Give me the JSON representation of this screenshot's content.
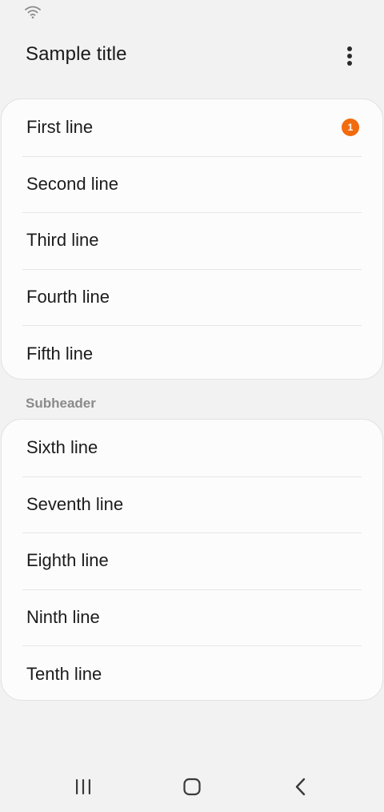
{
  "status_bar": {
    "wifi_icon": "wifi-icon"
  },
  "app_bar": {
    "title": "Sample title",
    "more_icon": "more-vertical-icon"
  },
  "group1": {
    "items": [
      {
        "label": "First line",
        "badge": "1"
      },
      {
        "label": "Second line"
      },
      {
        "label": "Third line"
      },
      {
        "label": "Fourth line"
      },
      {
        "label": "Fifth line"
      }
    ]
  },
  "subheader": "Subheader",
  "group2": {
    "items": [
      {
        "label": "Sixth line"
      },
      {
        "label": "Seventh line"
      },
      {
        "label": "Eighth line"
      },
      {
        "label": "Ninth line"
      },
      {
        "label": "Tenth line"
      }
    ]
  },
  "nav_bar": {
    "recents_icon": "recents-icon",
    "home_icon": "home-icon",
    "back_icon": "back-icon"
  },
  "colors": {
    "background": "#f2f2f2",
    "card": "#fcfcfc",
    "badge": "#f26b0f",
    "subheader": "#8a8a8a"
  }
}
